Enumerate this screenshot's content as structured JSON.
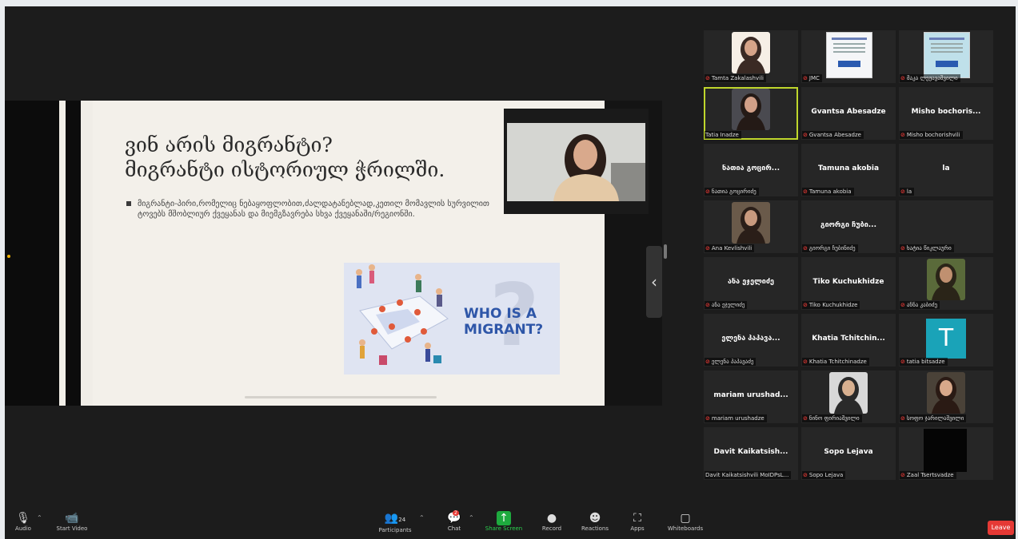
{
  "slide": {
    "title_line1": "ვინ არის მიგრანტი?",
    "title_line2": "მიგრანტი ისტორიულ ჭრილში.",
    "bullet": "მიგრანტი-პირი,რომელიც ნებაყოფლობით,ძალდატანებლად,კეთილ მომავლის სურვილით ტოვებს მშობლიურ ქვეყანას და მიემგზავრება სხვა ქვეყანაში/რეგიონში.",
    "art_text_line1": "WHO IS A",
    "art_text_line2": "MIGRANT?",
    "art_q": "?"
  },
  "share": {
    "collapse_glyph": "‹"
  },
  "gallery": [
    {
      "label": "Tamta Zakalashvili",
      "muted": true
    },
    {
      "label": "JMC",
      "muted": true
    },
    {
      "label": "მაკა ლეჟავაშვილი",
      "muted": true
    },
    {
      "label": "Tatia Inadze",
      "muted": false,
      "active": true
    },
    {
      "name": "Gvantsa Abesadze",
      "label": "Gvantsa Abesadze",
      "muted": true
    },
    {
      "name": "Misho bochoris...",
      "label": "Misho bochorishvili",
      "muted": true
    },
    {
      "name": "ნათია გოცირ...",
      "label": "ნათია გოცირიძე",
      "muted": true
    },
    {
      "name": "Tamuna akobia",
      "label": "Tamuna akobia",
      "muted": true
    },
    {
      "name": "la",
      "label": "la",
      "muted": true
    },
    {
      "label": "Ana Kevlishvili",
      "muted": true
    },
    {
      "name": "გიორგი ჩუბი...",
      "label": "გიორგი ჩუბინიძე",
      "muted": true
    },
    {
      "label": "ხატია წიკლაური",
      "muted": true
    },
    {
      "name": "ანა ეჯელიძე",
      "label": "ანა ეჯელიძე",
      "muted": true
    },
    {
      "name": "Tiko Kuchukhidze",
      "label": "Tiko Kuchukhidze",
      "muted": true
    },
    {
      "label": "ანნა კაბიძე",
      "muted": true
    },
    {
      "name": "ელენა პაპავა...",
      "label": "ელენა პაპავაძე",
      "muted": true
    },
    {
      "name": "Khatia Tchitchin...",
      "label": "Khatia Tchitchinadze",
      "muted": true
    },
    {
      "label": "tatia bitsadze",
      "muted": true,
      "letter": "T"
    },
    {
      "name": "mariam urushad...",
      "label": "mariam urushadze",
      "muted": true
    },
    {
      "label": "ნინო ფირიაშვილი",
      "muted": true
    },
    {
      "label": "სოფო ჯარილაშვილი",
      "muted": true
    },
    {
      "name": "Davit Kaikatsish...",
      "label": "Davit Kaikatsishvili MoIDPsL...",
      "muted": false
    },
    {
      "name": "Sopo Lejava",
      "label": "Sopo Lejava",
      "muted": true
    },
    {
      "label": "Zaal Tsertsvadze",
      "muted": true
    }
  ],
  "toolbar": {
    "audio": "Audio",
    "start_video": "Start Video",
    "participants": "Participants",
    "participants_count": "24",
    "chat": "Chat",
    "chat_badge": "2",
    "share_screen": "Share Screen",
    "record": "Record",
    "reactions": "Reactions",
    "apps": "Apps",
    "whiteboards": "Whiteboards",
    "leave": "Leave"
  },
  "colors": {
    "active_speaker": "#bfd62c",
    "share_green": "#1eaa3e",
    "leave_red": "#e53935"
  }
}
